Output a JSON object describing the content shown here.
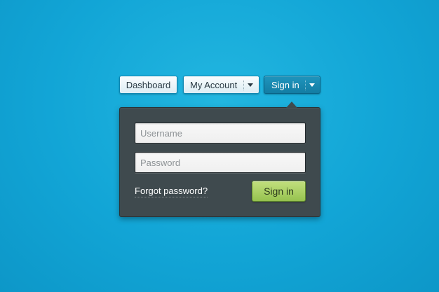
{
  "nav": {
    "dashboard_label": "Dashboard",
    "account_label": "My Account",
    "signin_label": "Sign in"
  },
  "login": {
    "username_placeholder": "Username",
    "password_placeholder": "Password",
    "forgot_label": "Forgot password?",
    "submit_label": "Sign in"
  },
  "colors": {
    "background": "#14a8d8",
    "panel": "#3f4a4e",
    "signin_accent": "#1a8ab2",
    "submit_green": "#a9d062"
  },
  "icons": {
    "account_dropdown": "chevron-down-icon",
    "signin_dropdown": "chevron-down-icon",
    "panel_pointer": "popover-arrow"
  }
}
